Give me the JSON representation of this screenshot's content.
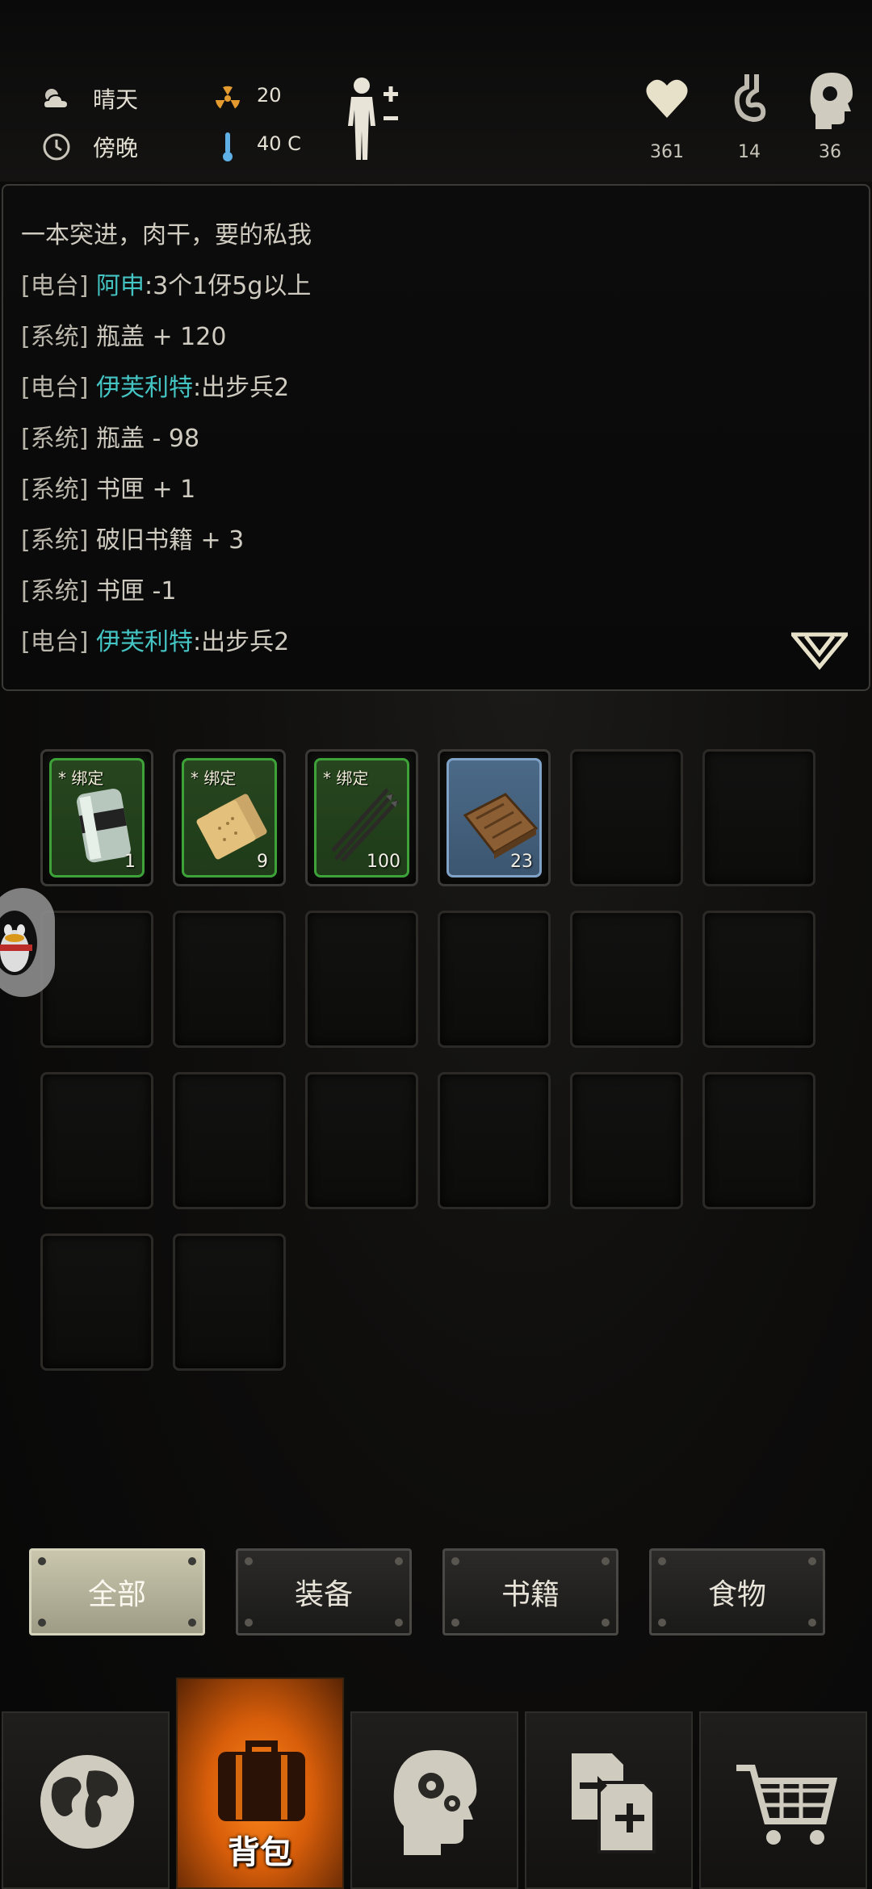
{
  "status": {
    "weather": "晴天",
    "time_of_day": "傍晚",
    "radiation": "20",
    "temperature": "40 C",
    "health": "361",
    "hunger": "14",
    "mind": "36"
  },
  "log": {
    "lines": [
      {
        "tag": "",
        "name": "",
        "text": "一本突进，肉干，要的私我"
      },
      {
        "tag": "[电台]",
        "name": "阿申",
        "text": ":3个1伢5g以上"
      },
      {
        "tag": "[系统]",
        "name": "",
        "text": "瓶盖 + 120"
      },
      {
        "tag": "[电台]",
        "name": "伊芙利特",
        "text": ":出步兵2"
      },
      {
        "tag": "[系统]",
        "name": "",
        "text": "瓶盖 - 98"
      },
      {
        "tag": "[系统]",
        "name": "",
        "text": "书匣 + 1"
      },
      {
        "tag": "[系统]",
        "name": "",
        "text": "破旧书籍 + 3"
      },
      {
        "tag": "[系统]",
        "name": "",
        "text": "书匣 -1"
      },
      {
        "tag": "[电台]",
        "name": "伊芙利特",
        "text": ":出步兵2"
      }
    ]
  },
  "inventory": {
    "items": [
      {
        "bind_label": "* 绑定",
        "qty": "1",
        "icon": "bandage-roll-icon",
        "rarity": "green"
      },
      {
        "bind_label": "* 绑定",
        "qty": "9",
        "icon": "crackers-icon",
        "rarity": "green"
      },
      {
        "bind_label": "* 绑定",
        "qty": "100",
        "icon": "arrows-icon",
        "rarity": "green"
      },
      {
        "bind_label": "",
        "qty": "23",
        "icon": "wooden-board-icon",
        "rarity": "blue"
      }
    ],
    "total_slots": 20
  },
  "filters": {
    "tabs": [
      "全部",
      "装备",
      "书籍",
      "食物"
    ],
    "active": 0
  },
  "nav": {
    "items": [
      {
        "icon": "world-map-icon",
        "label": ""
      },
      {
        "icon": "backpack-icon",
        "label": "背包"
      },
      {
        "icon": "brain-head-icon",
        "label": ""
      },
      {
        "icon": "trade-exchange-icon",
        "label": ""
      },
      {
        "icon": "shopping-cart-icon",
        "label": ""
      }
    ],
    "active": 1
  },
  "colors": {
    "player_name": "#45c4c4",
    "bind_green": "#3da238",
    "rare_blue": "#7fa2c6",
    "nav_active": "#e8700f"
  }
}
